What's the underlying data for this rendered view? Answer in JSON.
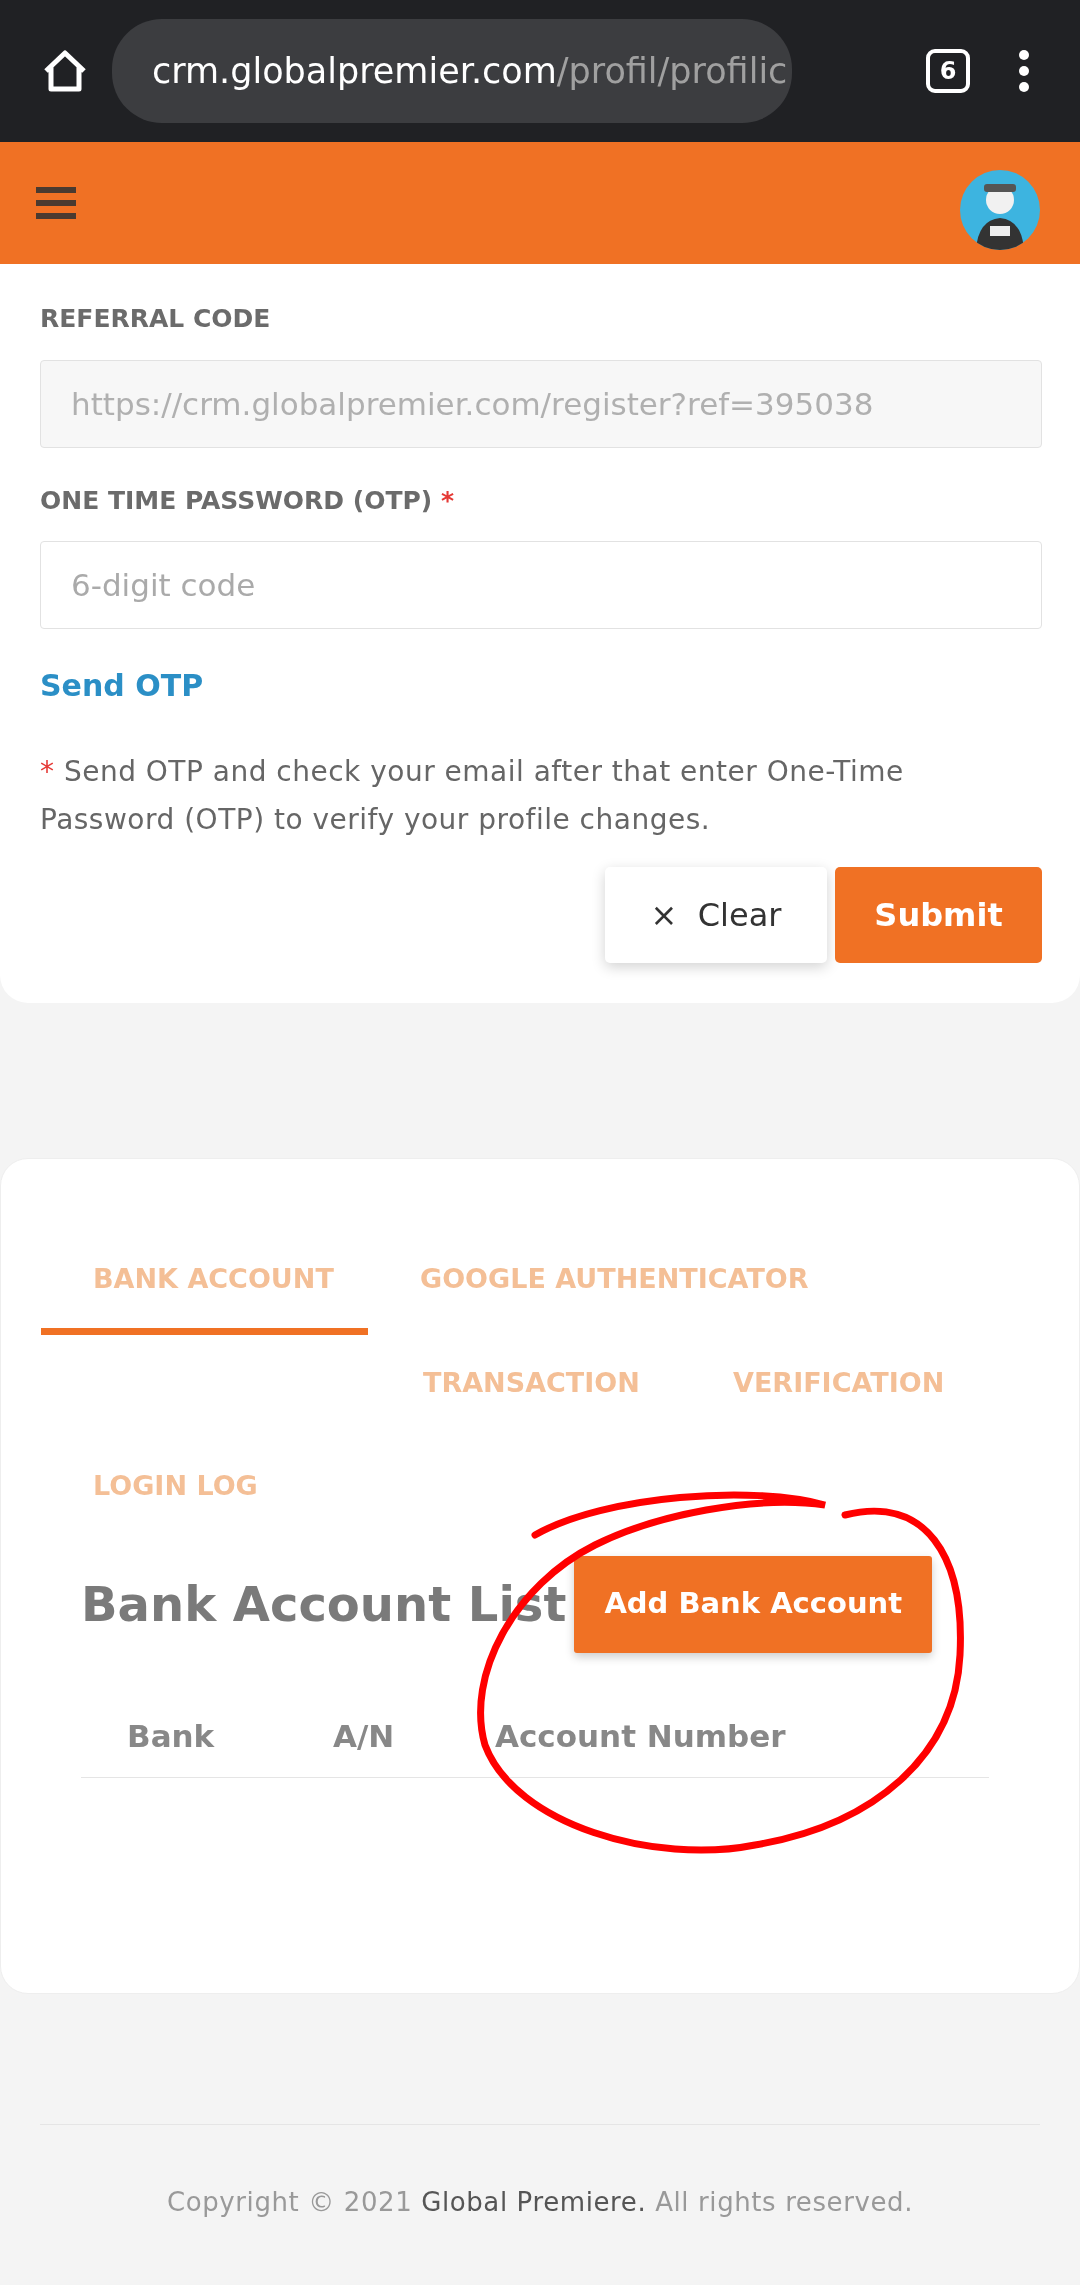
{
  "browser": {
    "url_host": "crm.globalpremier.com",
    "url_path": "/profil/profilic",
    "tab_count": "6"
  },
  "profile_form": {
    "fields": [
      {
        "label": "REFERRAL CODE",
        "required": false,
        "value": "https://crm.globalpremier.com/register?ref=395038",
        "disabled": true
      },
      {
        "label": "ONE TIME PASSWORD (OTP)",
        "required": true,
        "placeholder": "6-digit code",
        "disabled": false
      }
    ],
    "send_link": "Send OTP",
    "required_mark": "*",
    "note": "Send OTP and check your email after that enter One-Time Password (OTP) to verify your profile changes.",
    "buttons": [
      {
        "label": "Clear",
        "icon": "×",
        "kind": "secondary"
      },
      {
        "label": "Submit",
        "kind": "primary"
      }
    ]
  },
  "tabs": [
    {
      "label": "BANK ACCOUNT",
      "selected": true
    },
    {
      "label": "GOOGLE AUTHENTICATOR",
      "selected": false
    },
    {
      "label": "TRANSACTION",
      "selected": false
    },
    {
      "label": "VERIFICATION",
      "selected": false
    },
    {
      "label": "LOGIN LOG",
      "selected": false
    }
  ],
  "bank_list": {
    "title": "Bank Account List",
    "add_button": "Add Bank Account",
    "columns": [
      "Bank",
      "A/N",
      "Account Number"
    ]
  },
  "annotation": {
    "kind": "circle"
  },
  "footer": {
    "prefix": "Copyright © 2021 ",
    "brand": "Global Premiere.",
    "suffix": " All rights reserved."
  }
}
